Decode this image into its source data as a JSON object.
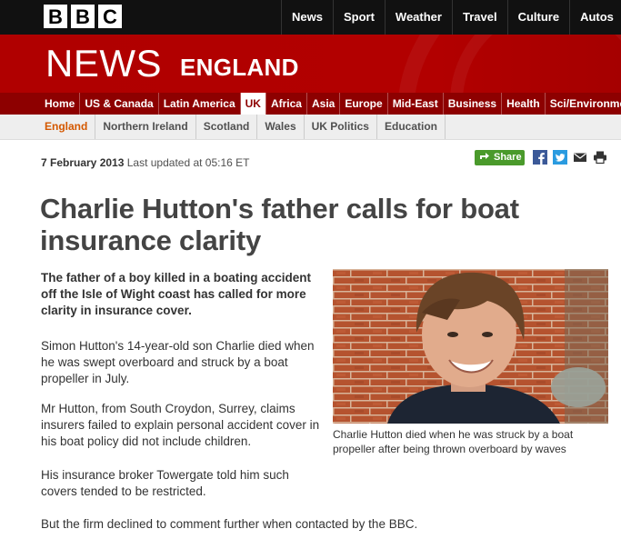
{
  "brand": {
    "letters": [
      "B",
      "B",
      "C"
    ]
  },
  "top_nav": [
    "News",
    "Sport",
    "Weather",
    "Travel",
    "Culture",
    "Autos"
  ],
  "masthead": {
    "title": "NEWS",
    "region": "ENGLAND"
  },
  "section_nav": [
    "Home",
    "US & Canada",
    "Latin America",
    "UK",
    "Africa",
    "Asia",
    "Europe",
    "Mid-East",
    "Business",
    "Health",
    "Sci/Environment"
  ],
  "section_active": "UK",
  "sub_nav": [
    "England",
    "Northern Ireland",
    "Scotland",
    "Wales",
    "UK Politics",
    "Education"
  ],
  "sub_active": "England",
  "article": {
    "date": "7 February 2013",
    "updated": "Last updated at 05:16 ET",
    "share_label": "Share",
    "headline": "Charlie Hutton's father calls for boat insurance clarity",
    "intro": "The father of a boy killed in a boating accident off the Isle of Wight coast has called for more clarity in insurance cover.",
    "paragraphs": [
      "Simon Hutton's 14-year-old son Charlie died when he was swept overboard and struck by a boat propeller in July.",
      "Mr Hutton, from South Croydon, Surrey, claims insurers failed to explain personal accident cover in his boat policy did not include children.",
      "His insurance broker Towergate told him such covers tended to be restricted.",
      "But the firm declined to comment further when contacted by the BBC."
    ],
    "caption": "Charlie Hutton died when he was struck by a boat propeller after being thrown overboard by waves"
  },
  "colors": {
    "bbc_red": "#b00000",
    "nav_red": "#8d0000",
    "share_green": "#4a9a2b",
    "subnav_active": "#d45800"
  },
  "icons": [
    "share-icon",
    "facebook-icon",
    "twitter-icon",
    "email-icon",
    "print-icon"
  ]
}
